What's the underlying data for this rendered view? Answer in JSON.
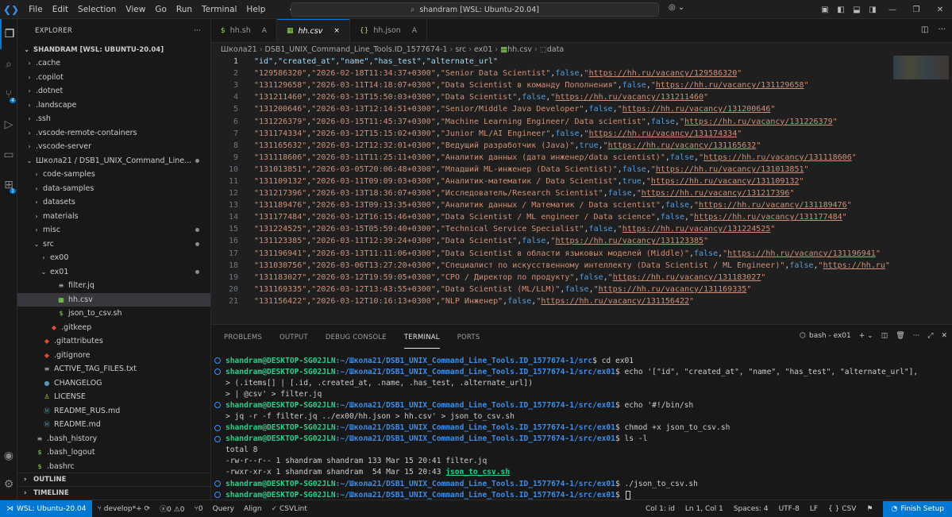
{
  "titlebar": {
    "menu": [
      "File",
      "Edit",
      "Selection",
      "View",
      "Go",
      "Run",
      "Terminal",
      "Help"
    ],
    "search": "shandram [WSL: Ubuntu-20.04]"
  },
  "explorer": {
    "header": "EXPLORER",
    "menu": "···",
    "section": "SHANDRAM [WSL: UBUNTU-20.04]",
    "rows": [
      {
        "depth": 0,
        "type": "folder",
        "open": false,
        "label": ".cache"
      },
      {
        "depth": 0,
        "type": "folder",
        "open": false,
        "label": ".copilot"
      },
      {
        "depth": 0,
        "type": "folder",
        "open": false,
        "label": ".dotnet"
      },
      {
        "depth": 0,
        "type": "folder",
        "open": false,
        "label": ".landscape"
      },
      {
        "depth": 0,
        "type": "folder",
        "open": false,
        "label": ".ssh"
      },
      {
        "depth": 0,
        "type": "folder",
        "open": false,
        "label": ".vscode-remote-containers"
      },
      {
        "depth": 0,
        "type": "folder",
        "open": false,
        "label": ".vscode-server"
      },
      {
        "depth": 0,
        "type": "folder",
        "open": true,
        "label": "Школа21 / DSB1_UNIX_Command_Line...",
        "dot": true
      },
      {
        "depth": 1,
        "type": "folder",
        "open": false,
        "label": "code-samples"
      },
      {
        "depth": 1,
        "type": "folder",
        "open": false,
        "label": "data-samples"
      },
      {
        "depth": 1,
        "type": "folder",
        "open": false,
        "label": "datasets"
      },
      {
        "depth": 1,
        "type": "folder",
        "open": false,
        "label": "materials"
      },
      {
        "depth": 1,
        "type": "folder",
        "open": false,
        "label": "misc",
        "dot": true
      },
      {
        "depth": 1,
        "type": "folder",
        "open": true,
        "label": "src",
        "dot": true
      },
      {
        "depth": 2,
        "type": "folder",
        "open": false,
        "label": "ex00"
      },
      {
        "depth": 2,
        "type": "folder",
        "open": true,
        "label": "ex01",
        "dot": true
      },
      {
        "depth": 3,
        "type": "file",
        "icon": "≡",
        "color": "c-txt",
        "label": "filter.jq"
      },
      {
        "depth": 3,
        "type": "file",
        "icon": "▦",
        "color": "c-csv",
        "label": "hh.csv",
        "selected": true
      },
      {
        "depth": 3,
        "type": "file",
        "icon": "$",
        "color": "c-sh",
        "label": "json_to_csv.sh"
      },
      {
        "depth": 2,
        "type": "file",
        "icon": "◆",
        "color": "c-git",
        "label": ".gitkeep"
      },
      {
        "depth": 1,
        "type": "file",
        "icon": "◆",
        "color": "c-git",
        "label": ".gitattributes"
      },
      {
        "depth": 1,
        "type": "file",
        "icon": "◆",
        "color": "c-git",
        "label": ".gitignore"
      },
      {
        "depth": 1,
        "type": "file",
        "icon": "≡",
        "color": "c-txt",
        "label": "ACTIVE_TAG_FILES.txt"
      },
      {
        "depth": 1,
        "type": "file",
        "icon": "●",
        "color": "c-md",
        "label": "CHANGELOG"
      },
      {
        "depth": 1,
        "type": "file",
        "icon": "♙",
        "color": "c-json",
        "label": "LICENSE"
      },
      {
        "depth": 1,
        "type": "file",
        "icon": "Ⓜ",
        "color": "c-md",
        "label": "README_RUS.md"
      },
      {
        "depth": 1,
        "type": "file",
        "icon": "Ⓜ",
        "color": "c-md",
        "label": "README.md"
      },
      {
        "depth": 0,
        "type": "file",
        "icon": "≡",
        "color": "c-txt",
        "label": ".bash_history"
      },
      {
        "depth": 0,
        "type": "file",
        "icon": "$",
        "color": "c-sh",
        "label": ".bash_logout"
      },
      {
        "depth": 0,
        "type": "file",
        "icon": "$",
        "color": "c-sh",
        "label": ".bashrc"
      }
    ],
    "outline": "OUTLINE",
    "timeline": "TIMELINE"
  },
  "tabs": [
    {
      "label": "hh.sh",
      "mark": "A",
      "icon": "$",
      "color": "c-sh",
      "active": false
    },
    {
      "label": "hh.csv",
      "mark": "×",
      "icon": "▦",
      "color": "c-csv",
      "active": true
    },
    {
      "label": "hh.json",
      "mark": "A",
      "icon": "{}",
      "color": "c-json",
      "active": false
    }
  ],
  "breadcrumb": [
    "Школа21",
    "DSB1_UNIX_Command_Line_Tools.ID_1577674-1",
    "src",
    "ex01",
    "hh.csv",
    "data"
  ],
  "csv_header": "\"id\",\"created_at\",\"name\",\"has_test\",\"alternate_url\"",
  "csv_rows": [
    {
      "id": "129586320",
      "date": "2026-02-18T11:34:37+0300",
      "name": "Senior Data Scientist",
      "test": "false",
      "url": "https://hh.ru/vacancy/129586320"
    },
    {
      "id": "131129658",
      "date": "2026-03-11T14:18:07+0300",
      "name": "Data Scientist в команду Пополнения",
      "test": "false",
      "url": "https://hh.ru/vacancy/131129658"
    },
    {
      "id": "131211460",
      "date": "2026-03-13T15:50:03+0300",
      "name": "Data Scientist",
      "test": "false",
      "url": "https://hh.ru/vacancy/131211460"
    },
    {
      "id": "131200646",
      "date": "2026-03-13T12:14:51+0300",
      "name": "Senior/Middle Java Developer",
      "test": "false",
      "url": "https://hh.ru/vacancy/131200646"
    },
    {
      "id": "131226379",
      "date": "2026-03-15T11:45:37+0300",
      "name": "Machine Learning Engineer/ Data scientist",
      "test": "false",
      "url": "https://hh.ru/vacancy/131226379"
    },
    {
      "id": "131174334",
      "date": "2026-03-12T15:15:02+0300",
      "name": "Junior ML/AI Engineer",
      "test": "false",
      "url": "https://hh.ru/vacancy/131174334"
    },
    {
      "id": "131165632",
      "date": "2026-03-12T12:32:01+0300",
      "name": "Ведущий разработчик (Java)",
      "test": "true",
      "url": "https://hh.ru/vacancy/131165632"
    },
    {
      "id": "131118606",
      "date": "2026-03-11T11:25:11+0300",
      "name": "Аналитик данных (дата инженер/data scientist)",
      "test": "false",
      "url": "https://hh.ru/vacancy/131118606"
    },
    {
      "id": "131013851",
      "date": "2026-03-05T20:06:48+0300",
      "name": "Младший ML-инженер (Data Scientist)",
      "test": "false",
      "url": "https://hh.ru/vacancy/131013851"
    },
    {
      "id": "131109132",
      "date": "2026-03-11T09:09:03+0300",
      "name": "Аналитик-математик / Data Scientist",
      "test": "true",
      "url": "https://hh.ru/vacancy/131109132"
    },
    {
      "id": "131217396",
      "date": "2026-03-13T18:36:07+0300",
      "name": "Исследователь/Research Scientist",
      "test": "false",
      "url": "https://hh.ru/vacancy/131217396"
    },
    {
      "id": "131189476",
      "date": "2026-03-13T09:13:35+0300",
      "name": "Аналитик данных / Математик / Data scientist",
      "test": "false",
      "url": "https://hh.ru/vacancy/131189476"
    },
    {
      "id": "131177484",
      "date": "2026-03-12T16:15:46+0300",
      "name": "Data Scientist / ML engineer / Data science",
      "test": "false",
      "url": "https://hh.ru/vacancy/131177484"
    },
    {
      "id": "131224525",
      "date": "2026-03-15T05:59:40+0300",
      "name": "Technical Service Specialist",
      "test": "false",
      "url": "https://hh.ru/vacancy/131224525"
    },
    {
      "id": "131123385",
      "date": "2026-03-11T12:39:24+0300",
      "name": "Data Scientist",
      "test": "false",
      "url": "https://hh.ru/vacancy/131123385"
    },
    {
      "id": "131196941",
      "date": "2026-03-13T11:11:06+0300",
      "name": "Data Scientist в области языковых моделей (Middle)",
      "test": "false",
      "url": "https://hh.ru/vacancy/131196941"
    },
    {
      "id": "131030756",
      "date": "2026-03-06T13:27:20+0300",
      "name": "Специалист по искусственному интеллекту (Data Scientist / ML Engineer)",
      "test": "false",
      "url": "https://hh.ru"
    },
    {
      "id": "131183027",
      "date": "2026-03-12T19:59:05+0300",
      "name": "CPO / Директор по продукту",
      "test": "false",
      "url": "https://hh.ru/vacancy/131183027"
    },
    {
      "id": "131169335",
      "date": "2026-03-12T13:43:55+0300",
      "name": "Data Scientist (ML/LLM)",
      "test": "false",
      "url": "https://hh.ru/vacancy/131169335"
    },
    {
      "id": "131156422",
      "date": "2026-03-12T10:16:13+0300",
      "name": "NLP Инженер",
      "test": "false",
      "url": "https://hh.ru/vacancy/131156422"
    }
  ],
  "panel": {
    "tabs": [
      "PROBLEMS",
      "OUTPUT",
      "DEBUG CONSOLE",
      "TERMINAL",
      "PORTS"
    ],
    "active": "TERMINAL",
    "shell": "bash - ex01"
  },
  "terminal": [
    {
      "dot": true,
      "user": "shandram@DESKTOP-SG02JLN",
      "path": ":~/Школа21/DSB1_UNIX_Command_Line_Tools.ID_1577674-1/src",
      "cmd": "$ cd ex01"
    },
    {
      "dot": true,
      "user": "shandram@DESKTOP-SG02JLN",
      "path": ":~/Школа21/DSB1_UNIX_Command_Line_Tools.ID_1577674-1/src/ex01",
      "cmd": "$ echo '[\"id\", \"created_at\", \"name\", \"has_test\", \"alternate_url\"],"
    },
    {
      "dot": false,
      "text": "> (.items[] | [.id, .created_at, .name, .has_test, .alternate_url])"
    },
    {
      "dot": false,
      "text": "> | @csv' > filter.jq"
    },
    {
      "dot": true,
      "user": "shandram@DESKTOP-SG02JLN",
      "path": ":~/Школа21/DSB1_UNIX_Command_Line_Tools.ID_1577674-1/src/ex01",
      "cmd": "$ echo '#!/bin/sh"
    },
    {
      "dot": false,
      "text": "> jq -r -f filter.jq ../ex00/hh.json > hh.csv' > json_to_csv.sh"
    },
    {
      "dot": true,
      "user": "shandram@DESKTOP-SG02JLN",
      "path": ":~/Школа21/DSB1_UNIX_Command_Line_Tools.ID_1577674-1/src/ex01",
      "cmd": "$ chmod +x json_to_csv.sh"
    },
    {
      "dot": true,
      "user": "shandram@DESKTOP-SG02JLN",
      "path": ":~/Школа21/DSB1_UNIX_Command_Line_Tools.ID_1577674-1/src/ex01",
      "cmd": "$ ls -l"
    },
    {
      "dot": false,
      "text": "total 8"
    },
    {
      "dot": false,
      "text": "-rw-r--r-- 1 shandram shandram 133 Mar 15 20:41 filter.jq"
    },
    {
      "dot": false,
      "text": "-rwxr-xr-x 1 shandram shandram  54 Mar 15 20:43 ",
      "green": "json_to_csv.sh"
    },
    {
      "dot": true,
      "user": "shandram@DESKTOP-SG02JLN",
      "path": ":~/Школа21/DSB1_UNIX_Command_Line_Tools.ID_1577674-1/src/ex01",
      "cmd": "$ ./json_to_csv.sh"
    },
    {
      "dot": true,
      "user": "shandram@DESKTOP-SG02JLN",
      "path": ":~/Школа21/DSB1_UNIX_Command_Line_Tools.ID_1577674-1/src/ex01",
      "cmd": "$ ",
      "cursor": true
    }
  ],
  "status": {
    "remote": "WSL: Ubuntu-20.04",
    "branch": "develop*+",
    "errors": "0",
    "warnings": "0",
    "ports": "0",
    "query": "Query",
    "align": "Align",
    "csvlint": "CSVLint",
    "pos": "Col 1: id",
    "lncol": "Ln 1, Col 1",
    "spaces": "Spaces: 4",
    "enc": "UTF-8",
    "eol": "LF",
    "lang": "CSV",
    "setup": "Finish Setup"
  }
}
